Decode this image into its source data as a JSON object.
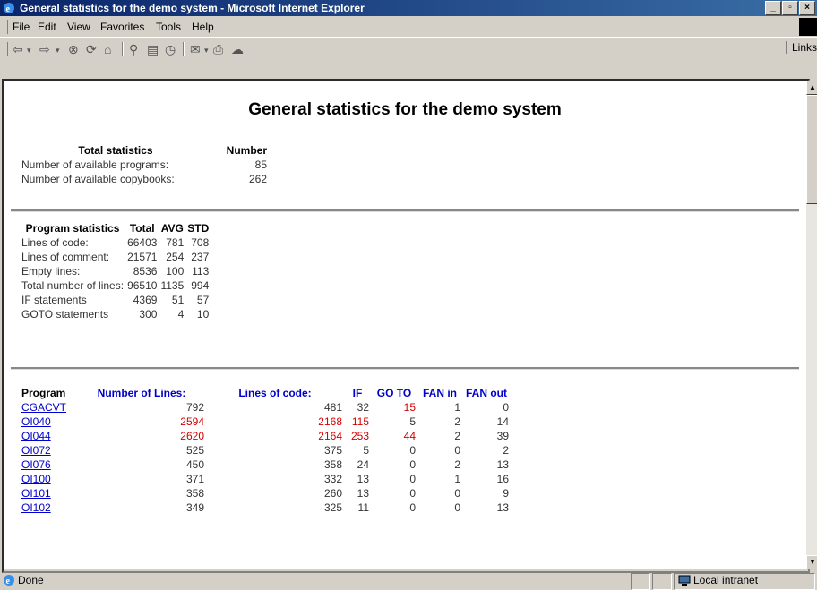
{
  "window": {
    "title": "General statistics for the demo system - Microsoft Internet Explorer"
  },
  "menu": [
    "File",
    "Edit",
    "View",
    "Favorites",
    "Tools",
    "Help"
  ],
  "toolbar": {
    "links_label": "Links"
  },
  "page": {
    "title": "General statistics for the demo system"
  },
  "total_stats": {
    "headers": [
      "Total statistics",
      "Number"
    ],
    "rows": [
      [
        "Number of available programs:",
        "85"
      ],
      [
        "Number of available copybooks:",
        "262"
      ]
    ]
  },
  "program_stats": {
    "headers": [
      "Program statistics",
      "Total",
      "AVG",
      "STD"
    ],
    "rows": [
      [
        "Lines of code:",
        "66403",
        "781",
        "708"
      ],
      [
        "Lines of comment:",
        "21571",
        "254",
        "237"
      ],
      [
        "Empty lines:",
        "8536",
        "100",
        "113"
      ],
      [
        "Total number of lines:",
        "96510",
        "1135",
        "994"
      ],
      [
        "IF statements",
        "4369",
        "51",
        "57"
      ],
      [
        "GOTO statements",
        "300",
        "4",
        "10"
      ]
    ]
  },
  "program_table": {
    "headers": [
      "Program",
      "Number of Lines:",
      "Lines of code:",
      "IF",
      "GO TO",
      "FAN in",
      "FAN out"
    ],
    "rows": [
      [
        "CGACVT",
        "792",
        "481",
        "32",
        "15",
        "1",
        "0"
      ],
      [
        "OI040",
        "2594",
        "2168",
        "115",
        "5",
        "2",
        "14"
      ],
      [
        "OI044",
        "2620",
        "2164",
        "253",
        "44",
        "2",
        "39"
      ],
      [
        "OI072",
        "525",
        "375",
        "5",
        "0",
        "0",
        "2"
      ],
      [
        "OI076",
        "450",
        "358",
        "24",
        "0",
        "2",
        "13"
      ],
      [
        "OI100",
        "371",
        "332",
        "13",
        "0",
        "1",
        "16"
      ],
      [
        "OI101",
        "358",
        "260",
        "13",
        "0",
        "0",
        "9"
      ],
      [
        "OI102",
        "349",
        "325",
        "11",
        "0",
        "0",
        "13"
      ]
    ],
    "highlight_color": "#d40000"
  },
  "status": {
    "text": "Done",
    "zone": "Local intranet"
  }
}
